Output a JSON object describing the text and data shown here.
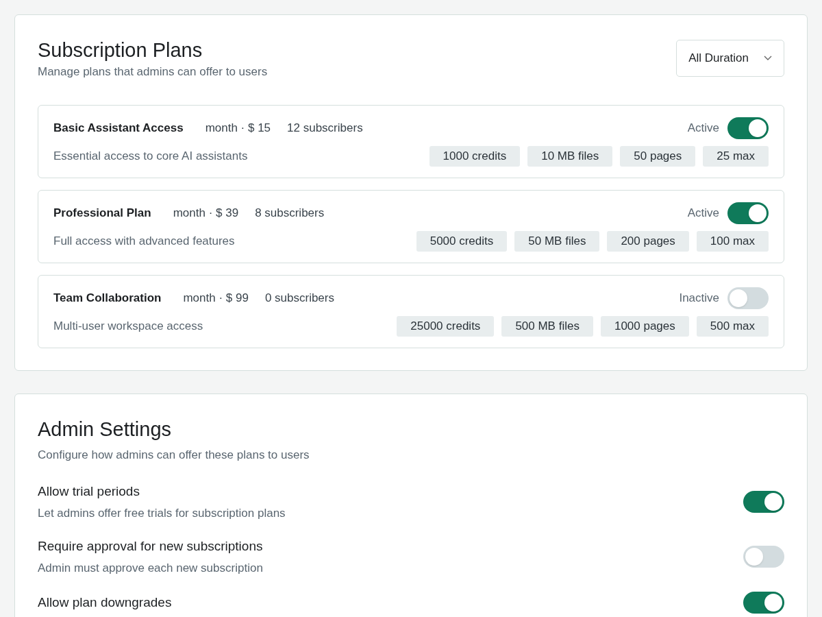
{
  "plans_panel": {
    "title": "Subscription Plans",
    "subtitle": "Manage plans that admins can offer to users",
    "duration_filter": {
      "value": "All Duration"
    },
    "plans": [
      {
        "name": "Basic Assistant Access",
        "price": "month · $ 15",
        "subscribers": "12 subscribers",
        "description": "Essential access to core AI assistants",
        "status": "Active",
        "on": true,
        "tags": [
          "1000 credits",
          "10 MB files",
          "50 pages",
          "25 max"
        ]
      },
      {
        "name": "Professional Plan",
        "price": "month · $ 39",
        "subscribers": "8 subscribers",
        "description": "Full access with advanced features",
        "status": "Active",
        "on": true,
        "tags": [
          "5000 credits",
          "50 MB files",
          "200 pages",
          "100 max"
        ]
      },
      {
        "name": "Team Collaboration",
        "price": "month · $ 99",
        "subscribers": "0 subscribers",
        "description": "Multi-user workspace access",
        "status": "Inactive",
        "on": false,
        "tags": [
          "25000 credits",
          "500 MB files",
          "1000 pages",
          "500 max"
        ]
      }
    ]
  },
  "admin_settings": {
    "title": "Admin Settings",
    "subtitle": "Configure how admins can offer these plans to users",
    "settings": [
      {
        "label": "Allow trial periods",
        "description": "Let admins offer free trials for subscription plans",
        "on": true
      },
      {
        "label": "Require approval for new subscriptions",
        "description": "Admin must approve each new subscription",
        "on": false
      },
      {
        "label": "Allow plan downgrades",
        "on": true
      }
    ]
  }
}
